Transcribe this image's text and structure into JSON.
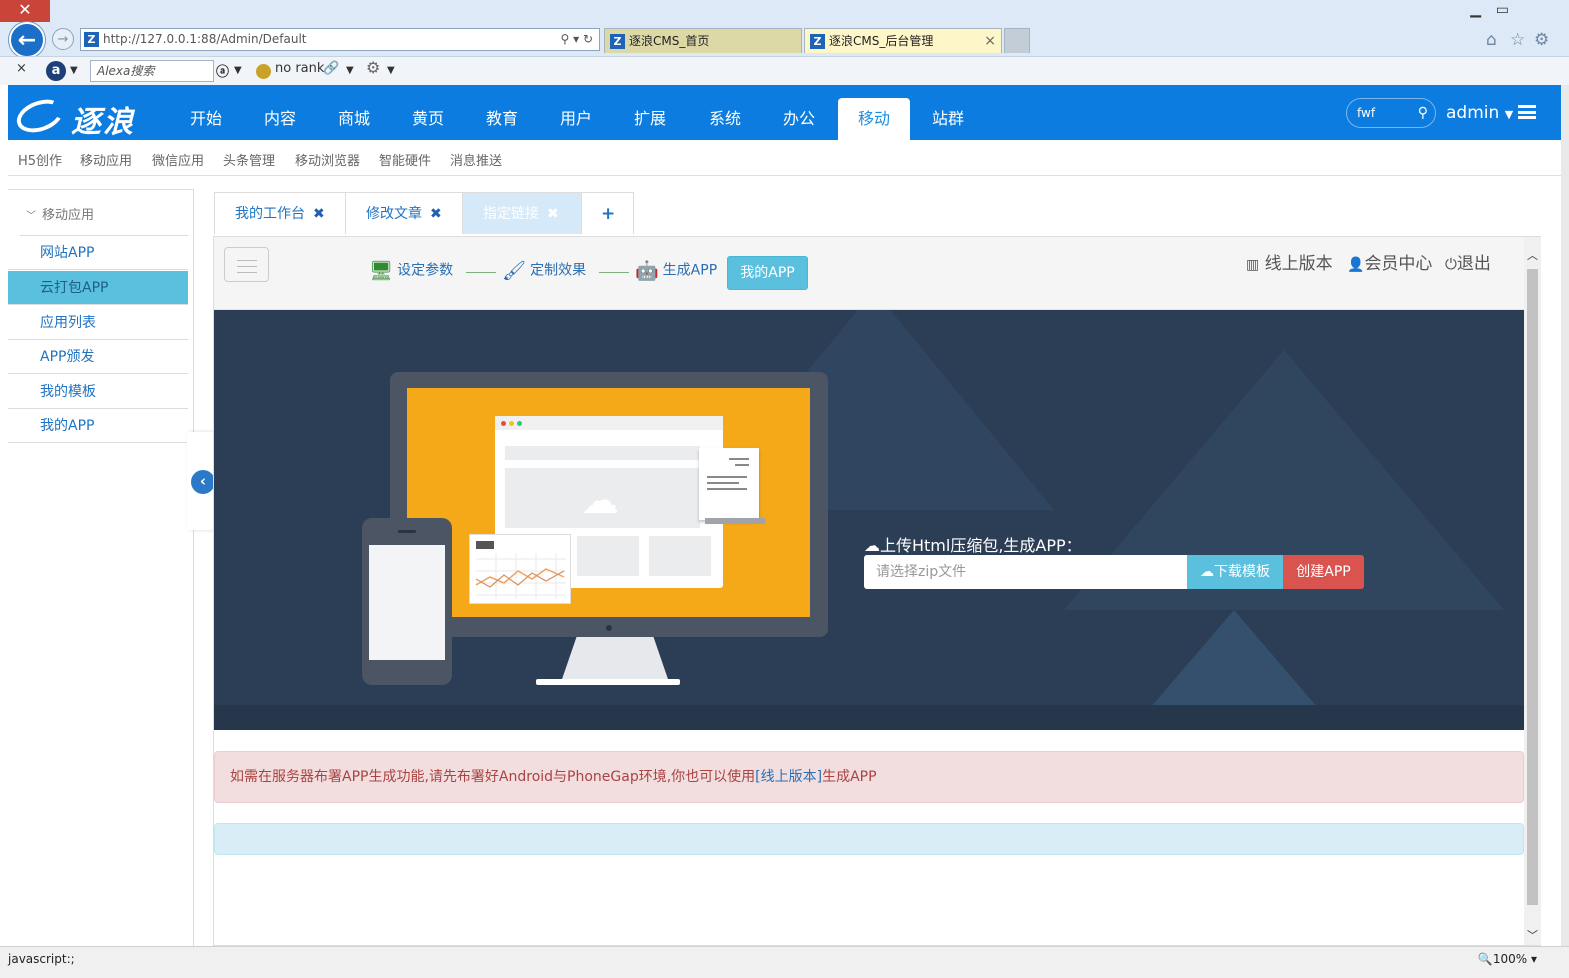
{
  "browser": {
    "url": "http://127.0.0.1:88/Admin/Default",
    "tabs": [
      {
        "label": "逐浪CMS_首页"
      },
      {
        "label": "逐浪CMS_后台管理"
      }
    ],
    "alexa_placeholder": "Alexa搜索",
    "rank_text": "no rank",
    "status_left": "javascript:;",
    "zoom": "100%"
  },
  "header": {
    "logo_text": "逐浪",
    "nav": [
      "开始",
      "内容",
      "商城",
      "黄页",
      "教育",
      "用户",
      "扩展",
      "系统",
      "办公",
      "移动",
      "站群"
    ],
    "active_nav": "移动",
    "search_value": "fwf",
    "user": "admin"
  },
  "subnav": [
    "H5创作",
    "移动应用",
    "微信应用",
    "头条管理",
    "移动浏览器",
    "智能硬件",
    "消息推送"
  ],
  "sidebar": {
    "section": "移动应用",
    "items": [
      {
        "label": "网站APP"
      },
      {
        "label": "云打包APP"
      },
      {
        "label": "应用列表"
      },
      {
        "label": "APP颁发"
      },
      {
        "label": "我的模板"
      },
      {
        "label": "我的APP"
      }
    ],
    "active_item": "云打包APP"
  },
  "content_tabs": [
    {
      "label": "我的工作台"
    },
    {
      "label": "修改文章"
    },
    {
      "label": "指定链接"
    }
  ],
  "toolbar": {
    "steps": [
      {
        "label": "设定参数",
        "icon": "monitor-icon"
      },
      {
        "label": "定制效果",
        "icon": "brush-icon"
      },
      {
        "label": "生成APP",
        "icon": "android-icon"
      }
    ],
    "my_app_button": "我的APP",
    "links": [
      {
        "label": "线上版本",
        "icon": "book-icon"
      },
      {
        "label": "会员中心",
        "icon": "user-icon"
      },
      {
        "label": "退出",
        "icon": "power-icon"
      }
    ]
  },
  "banner": {
    "upload_title": "上传Html压缩包,生成APP：",
    "zip_placeholder": "请选择zip文件",
    "download_button": "下载模板",
    "create_button": "创建APP"
  },
  "alert": {
    "text_before": "如需在服务器布署APP生成功能,请先布署好Android与PhoneGap环境,你也可以使用",
    "link": "[线上版本]",
    "text_after": "生成APP"
  },
  "colors": {
    "header_blue": "#0c7ce0",
    "active_sidebar": "#5bc0de",
    "banner_bg": "#2b3e55",
    "create_red": "#d9534f"
  }
}
